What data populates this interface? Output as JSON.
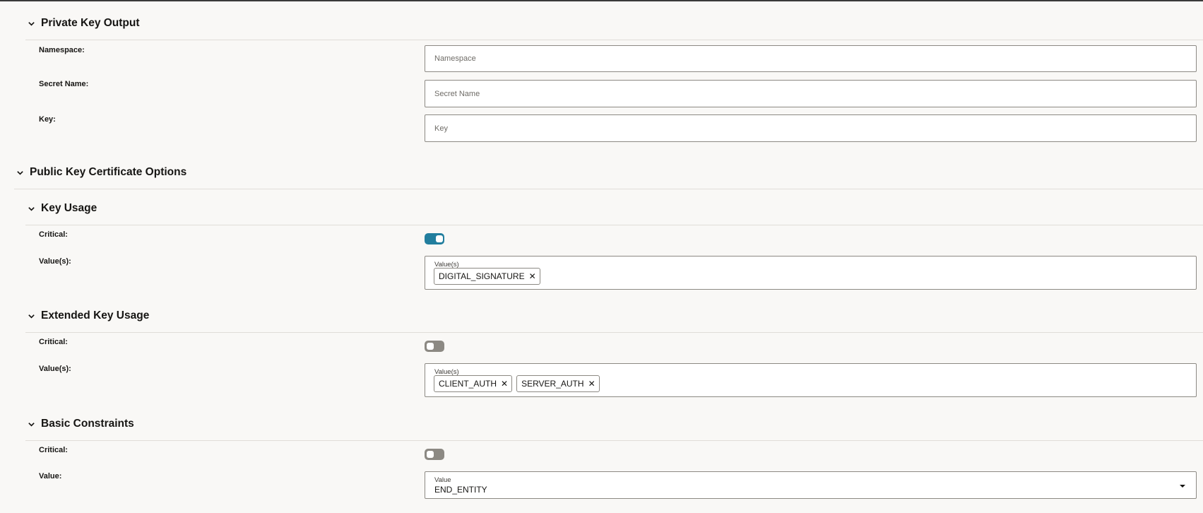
{
  "private_key_output": {
    "title": "Private Key Output",
    "fields": {
      "namespace": {
        "label": "Namespace:",
        "placeholder": "Namespace"
      },
      "secret_name": {
        "label": "Secret Name:",
        "placeholder": "Secret Name"
      },
      "key": {
        "label": "Key:",
        "placeholder": "Key"
      }
    }
  },
  "public_key_certificate_options": {
    "title": "Public Key Certificate Options",
    "key_usage": {
      "title": "Key Usage",
      "critical_label": "Critical:",
      "critical": true,
      "values_label": "Value(s):",
      "values_inner_label": "Value(s)",
      "values": [
        "DIGITAL_SIGNATURE"
      ]
    },
    "extended_key_usage": {
      "title": "Extended Key Usage",
      "critical_label": "Critical:",
      "critical": false,
      "values_label": "Value(s):",
      "values_inner_label": "Value(s)",
      "values": [
        "CLIENT_AUTH",
        "SERVER_AUTH"
      ]
    },
    "basic_constraints": {
      "title": "Basic Constraints",
      "critical_label": "Critical:",
      "critical": false,
      "value_label": "Value:",
      "value_inner_label": "Value",
      "value": "END_ENTITY"
    }
  },
  "icons": {
    "collapse": "chevron-down-icon",
    "remove": "close-icon",
    "dropdown": "caret-down-icon"
  },
  "colors": {
    "toggle_on": "#227e9e",
    "toggle_off": "#8c8983"
  }
}
